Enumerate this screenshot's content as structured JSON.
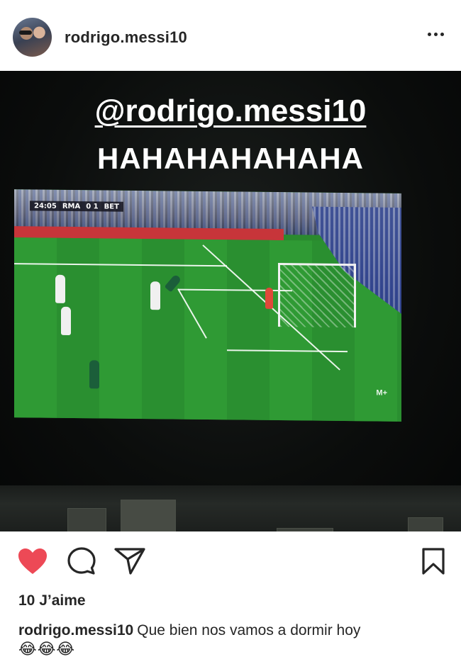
{
  "header": {
    "username": "rodrigo.messi10",
    "more_icon": "more-horizontal-icon"
  },
  "media": {
    "overlay_handle": "@rodrigo.messi10",
    "overlay_laugh": "HAHAHAHAHAHA",
    "scoreboard": {
      "clock": "24:05",
      "home": "RMA",
      "score": "0 1",
      "away": "BET"
    },
    "channel_logo": "M+"
  },
  "actions": {
    "like_icon": "heart-filled-icon",
    "comment_icon": "comment-bubble-icon",
    "share_icon": "paper-plane-icon",
    "save_icon": "bookmark-icon",
    "like_color": "#ed4956"
  },
  "likes": {
    "text": "10 J’aime"
  },
  "caption": {
    "username": "rodrigo.messi10",
    "text": "Que bien nos vamos a dormir hoy",
    "emoji": "😂😂😂"
  }
}
